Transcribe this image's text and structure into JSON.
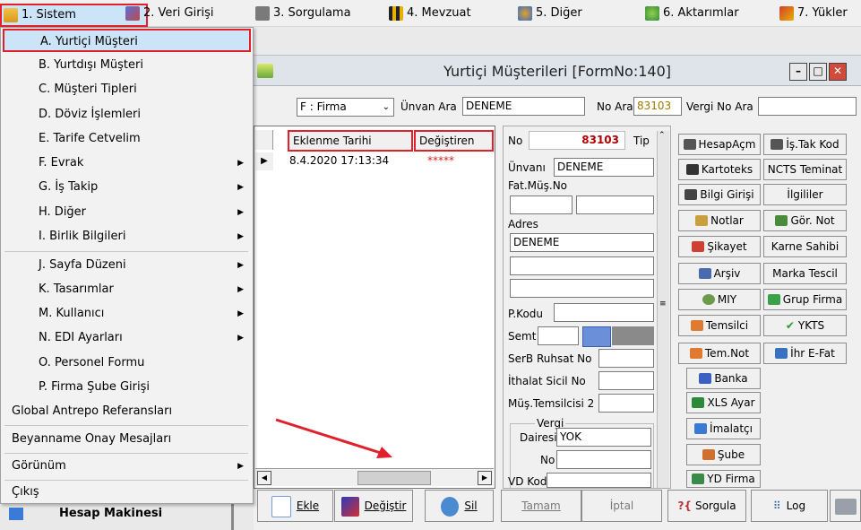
{
  "menubar": {
    "items": [
      {
        "label": "1. Sistem",
        "icon": "user-icon"
      },
      {
        "label": "2. Veri Girişi",
        "icon": "pencil-icon"
      },
      {
        "label": "3. Sorgulama",
        "icon": "magnifier-icon"
      },
      {
        "label": "4. Mevzuat",
        "icon": "books-icon"
      },
      {
        "label": "5. Diğer",
        "icon": "gear-people-icon"
      },
      {
        "label": "6. Aktarımlar",
        "icon": "gears-icon"
      },
      {
        "label": "7. Yükler",
        "icon": "loads-icon"
      }
    ]
  },
  "dropdown": {
    "items": [
      {
        "label": "A. Yurtiçi Müşteri"
      },
      {
        "label": "B. Yurtdışı Müşteri"
      },
      {
        "label": "C. Müşteri Tipleri"
      },
      {
        "label": "D. Döviz İşlemleri"
      },
      {
        "label": "E. Tarife Cetvelim"
      },
      {
        "label": "F. Evrak"
      },
      {
        "label": "G. İş Takip"
      },
      {
        "label": "H. Diğer"
      },
      {
        "label": "I. Birlik Bilgileri"
      },
      {
        "label": "J. Sayfa Düzeni"
      },
      {
        "label": "K. Tasarımlar"
      },
      {
        "label": "M. Kullanıcı"
      },
      {
        "label": "N. EDI Ayarları"
      },
      {
        "label": "O. Personel Formu"
      },
      {
        "label": "P. Firma Şube Girişi"
      },
      {
        "label": "Global Antrepo Referansları"
      },
      {
        "label": "Beyanname Onay Mesajları"
      },
      {
        "label": "Görünüm"
      },
      {
        "label": "Çıkış"
      }
    ]
  },
  "background": {
    "hesap_label": "Hesap Makinesi"
  },
  "form": {
    "title": "Yurtiçi Müşterileri [FormNo:140]",
    "filter": {
      "type_value": "F : Firma",
      "unvan_label": "Ünvan Ara",
      "unvan_value": "DENEME",
      "no_label": "No Ara",
      "no_value": "83103",
      "vergi_label": "Vergi No Ara",
      "vergi_value": ""
    },
    "grid": {
      "headers": [
        "Eklenme Tarihi",
        "Değiştiren"
      ],
      "rows": [
        {
          "date": "8.4.2020 17:13:34",
          "user": "*****"
        }
      ]
    },
    "detail": {
      "no_label": "No",
      "no_value": "83103",
      "tip_label": "Tip",
      "unvan_label": "Ünvanı",
      "unvan_value": "DENEME",
      "fat_label": "Fat.Müş.No",
      "adres_label": "Adres",
      "adres_value": "DENEME",
      "pkodu_label": "P.Kodu",
      "semt_label": "Semt",
      "serb_label": "SerB Ruhsat No",
      "ithalat_label": "İthalat Sicil No",
      "temsilci_label": "Müş.Temsilcisi 2",
      "vergi_group": "Vergi",
      "dairesi_label": "Dairesi",
      "dairesi_value": "YOK",
      "vno_label": "No",
      "vdkod_label": "VD Kod"
    },
    "buttons_left": [
      "HesapAçm",
      "Kartoteks",
      "Bilgi Girişi",
      "Notlar",
      "Şikayet",
      "Arşiv",
      "MIY",
      "Temsilci",
      "Tem.Not",
      "Banka",
      "XLS Ayar",
      "İmalatçı",
      "Şube",
      "YD Firma"
    ],
    "buttons_right": [
      "İş.Tak Kod",
      "NCTS Teminat",
      "İlgililer",
      "Gör. Not",
      "Karne Sahibi",
      "Marka Tescil",
      "Grup Firma",
      "YKTS",
      "İhr E-Fat"
    ],
    "bottom": {
      "ekle": "Ekle",
      "degistir": "Değiştir",
      "sil": "Sil",
      "tamam": "Tamam",
      "iptal": "İptal",
      "sorgula": "Sorgula",
      "log": "Log"
    }
  },
  "colors": {
    "highlight_border": "#e0202a",
    "selection": "#cce4f7",
    "number_red": "#b00000",
    "arrow_red": "#e0202a"
  }
}
